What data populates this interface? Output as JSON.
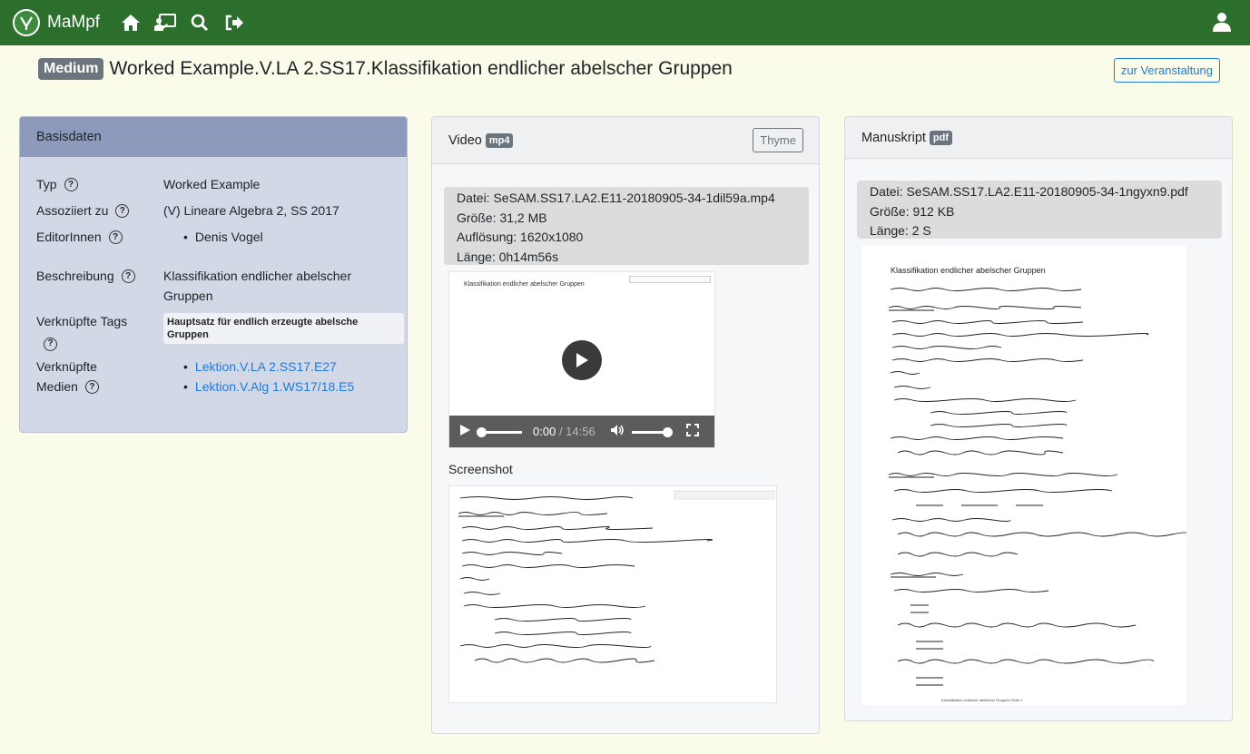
{
  "nav": {
    "brand": "MaMpf",
    "icons": [
      "home-icon",
      "lecture-icon",
      "search-icon",
      "logout-icon",
      "user-icon"
    ]
  },
  "title": {
    "badge": "Medium",
    "text": "Worked Example.V.LA 2.SS17.Klassifikation endlicher abelscher Gruppen",
    "button": "zur Veranstaltung"
  },
  "basis": {
    "header": "Basisdaten",
    "typ_label": "Typ",
    "typ_value": "Worked Example",
    "assoz_label": "Assoziiert zu",
    "assoz_value": "(V) Lineare Algebra 2, SS 2017",
    "editor_label": "EditorInnen",
    "editor_value": "Denis Vogel",
    "beschr_label": "Beschreibung",
    "beschr_value": "Klassifikation endlicher abelscher Gruppen",
    "tags_label": "Verknüpfte Tags",
    "tag": "Hauptsatz für endlich erzeugte abelsche Gruppen",
    "medien_label_1": "Verknüpfte",
    "medien_label_2": "Medien",
    "medien": [
      "Lektion.V.LA 2.SS17.E27",
      "Lektion.V.Alg 1.WS17/18.E5"
    ]
  },
  "video": {
    "header": "Video",
    "format": "mp4",
    "thyme": "Thyme",
    "datei": "Datei: SeSAM.SS17.LA2.E11-20180905-34-1dil59a.mp4",
    "groesse": "Größe: 31,2 MB",
    "aufloesung": "Auflösung: 1620x1080",
    "laenge": "Länge: 0h14m56s",
    "frame_title": "Klassifikation endlicher abelscher Gruppen",
    "time_current": "0:00",
    "time_total": "/ 14:56",
    "screenshot_label": "Screenshot"
  },
  "manuskript": {
    "header": "Manuskript",
    "format": "pdf",
    "datei": "Datei: SeSAM.SS17.LA2.E11-20180905-34-1ngyxn9.pdf",
    "groesse": "Größe: 912 KB",
    "laenge": "Länge: 2 S",
    "page_title": "Klassifikation endlicher abelscher Gruppen",
    "page_footer": "Klassifikation endlicher abelscher Gruppen Seite 1"
  }
}
